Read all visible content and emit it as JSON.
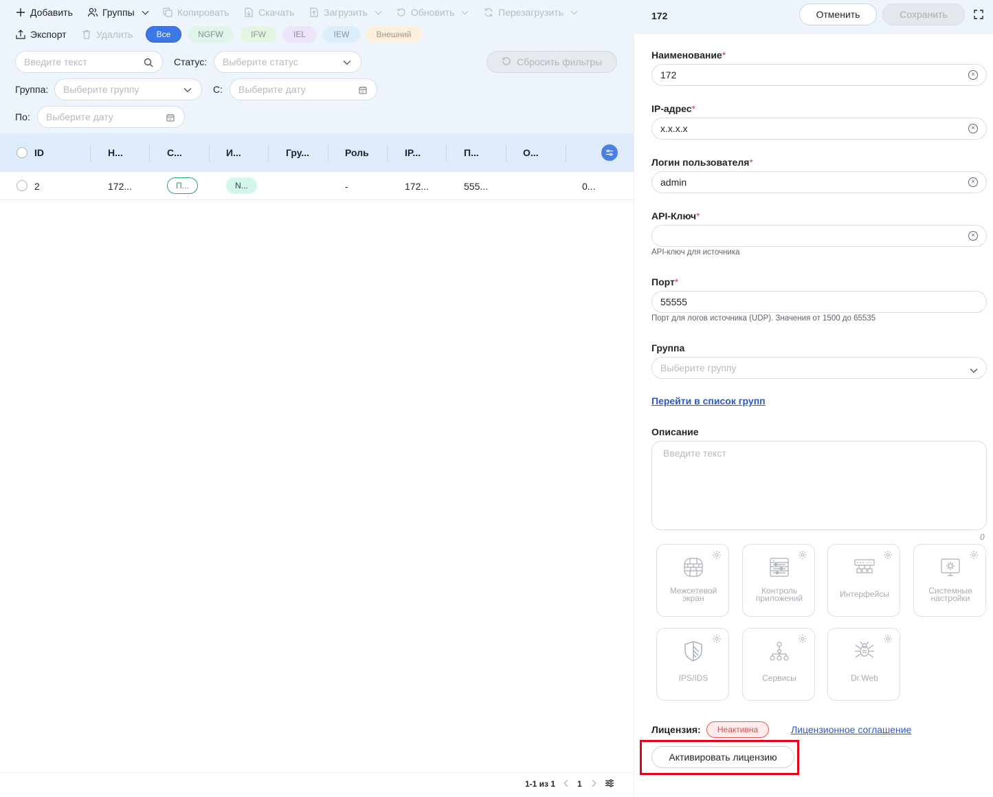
{
  "toolbar": {
    "add": "Добавить",
    "groups": "Группы",
    "copy": "Копировать",
    "download": "Скачать",
    "upload": "Загрузить",
    "update": "Обновить",
    "reboot": "Перезагрузить",
    "export": "Экспорт",
    "delete": "Удалить"
  },
  "type_filters": [
    "Все",
    "NGFW",
    "IFW",
    "IEL",
    "IEW",
    "Внешний"
  ],
  "filters": {
    "search_placeholder": "Введите текст",
    "status_label": "Статус:",
    "status_placeholder": "Выберите статус",
    "reset": "Сбросить фильтры",
    "group_label": "Группа:",
    "group_placeholder": "Выберите группу",
    "from_label": "С:",
    "from_placeholder": "Выберите дату",
    "to_label": "По:",
    "to_placeholder": "Выберите дату"
  },
  "table": {
    "columns": [
      "ID",
      "Н...",
      "С...",
      "И...",
      "Гру...",
      "Роль",
      "IP...",
      "П...",
      "О..."
    ],
    "rows": [
      {
        "id": "2",
        "name": "172...",
        "status": "П...",
        "type": "N...",
        "group": "",
        "role": "-",
        "ip": "172...",
        "port": "555...",
        "extra": "0..."
      }
    ]
  },
  "pagination": {
    "range": "1-1 из 1",
    "page": "1"
  },
  "panel": {
    "title": "172",
    "cancel": "Отменить",
    "save": "Сохранить",
    "name_label": "Наименование",
    "name_value": "172",
    "ip_label": "IP-адрес",
    "ip_value": "x.x.x.x",
    "login_label": "Логин пользователя",
    "login_value": "admin",
    "api_label": "API-Ключ",
    "api_value": "",
    "api_hint": "API-ключ для источника",
    "port_label": "Порт",
    "port_value": "55555",
    "port_hint": "Порт для логов источника (UDP). Значения от 1500 до 65535",
    "group_label": "Группа",
    "group_placeholder": "Выберите группу",
    "group_link": "Перейти в список групп",
    "desc_label": "Описание",
    "desc_placeholder": "Введите текст",
    "desc_counter": "0",
    "required_mark": "*"
  },
  "modules": [
    {
      "l1": "Межсетевой",
      "l2": "экран",
      "icon": "firewall-icon"
    },
    {
      "l1": "Контроль",
      "l2": "приложений",
      "icon": "app-control-icon"
    },
    {
      "l1": "Интерфейсы",
      "l2": "",
      "icon": "interfaces-icon"
    },
    {
      "l1": "Системные",
      "l2": "настройки",
      "icon": "system-settings-icon"
    },
    {
      "l1": "IPS/IDS",
      "l2": "",
      "icon": "shield-icon"
    },
    {
      "l1": "Сервисы",
      "l2": "",
      "icon": "services-icon"
    },
    {
      "l1": "Dr.Web",
      "l2": "",
      "icon": "drweb-spider-icon"
    }
  ],
  "license": {
    "label": "Лицензия:",
    "status": "Неактивна",
    "agreement": "Лицензионное соглашение",
    "activate": "Активировать лицензию"
  }
}
